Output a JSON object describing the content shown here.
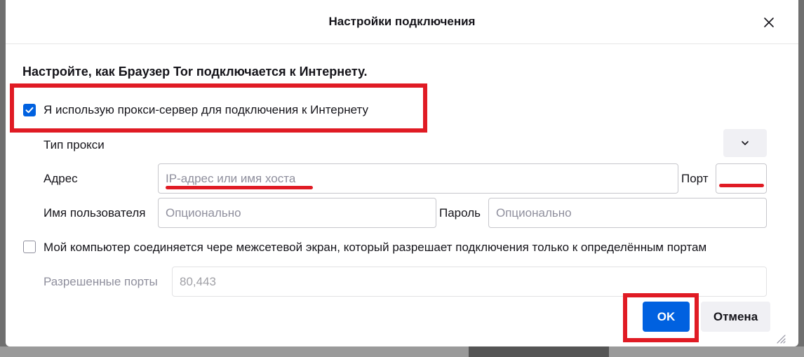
{
  "dialog": {
    "title": "Настройки подключения",
    "heading": "Настройте, как Браузер Tor подключается к Интернету."
  },
  "proxy": {
    "checkbox_label": "Я использую прокси-сервер для подключения к Интернету",
    "checked": true,
    "type_label": "Тип прокси",
    "type_value": "",
    "address_label": "Адрес",
    "address_placeholder": "IP-адрес или имя хоста",
    "port_label": "Порт",
    "port_value": "",
    "username_label": "Имя пользователя",
    "username_placeholder": "Опционально",
    "password_label": "Пароль",
    "password_placeholder": "Опционально"
  },
  "firewall": {
    "checkbox_label": "Мой компьютер соединяется чере межсетевой экран, который разрешает подключения только к определённым портам",
    "checked": false,
    "ports_label": "Разрешенные порты",
    "ports_value": "80,443"
  },
  "buttons": {
    "ok": "OK",
    "cancel": "Отмена"
  },
  "colors": {
    "accent": "#0061e0",
    "annotation": "#e01b24"
  },
  "icons": [
    "close-icon",
    "checkmark-icon",
    "chevron-down-icon",
    "resize-grip-icon"
  ]
}
